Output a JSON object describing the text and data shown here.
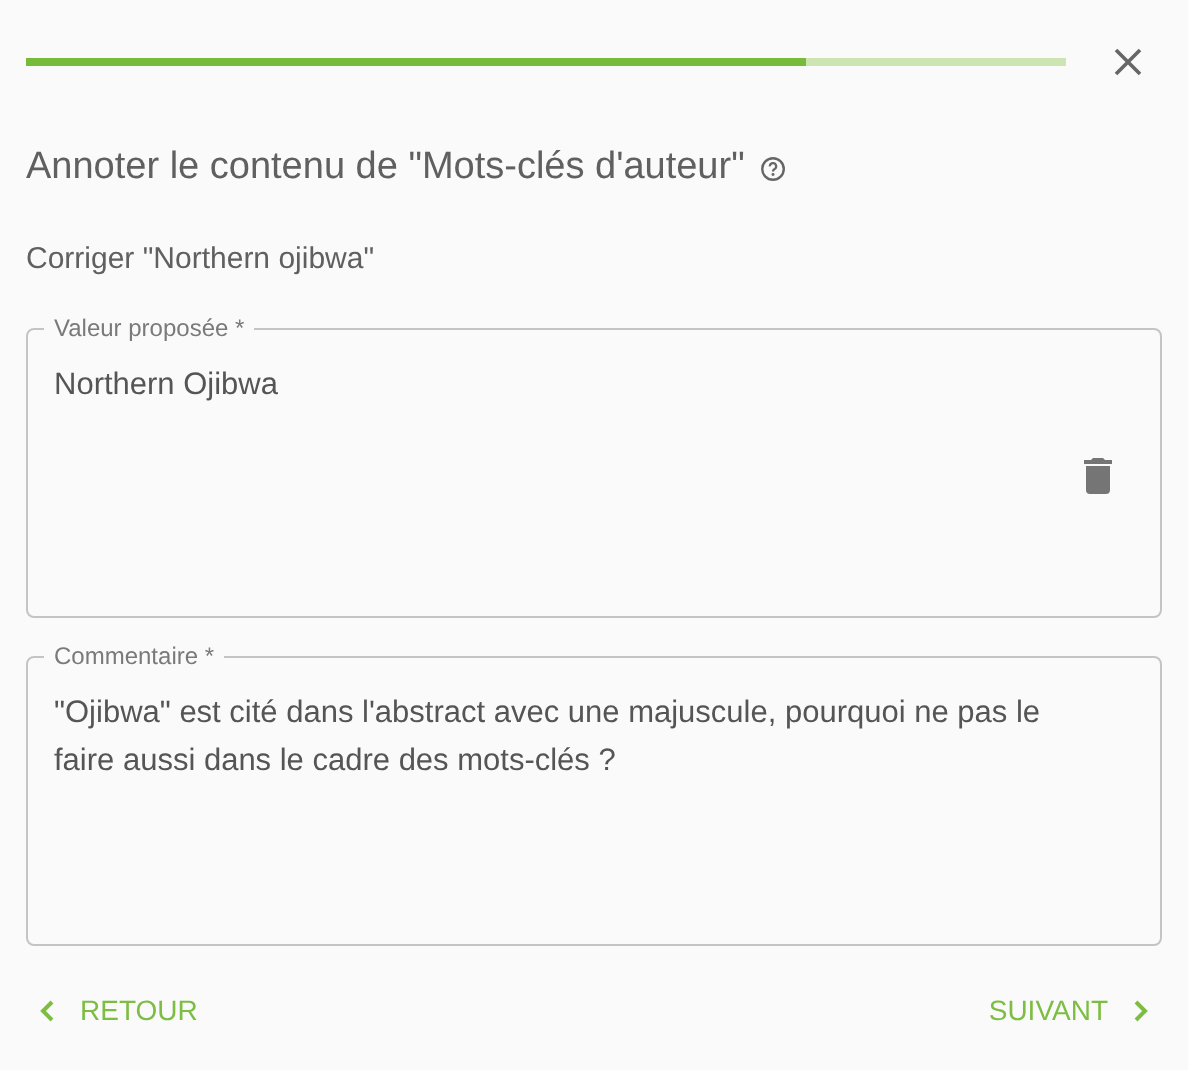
{
  "progress": {
    "level": 0.75
  },
  "title": "Annoter le contenu de \"Mots-clés d'auteur\"",
  "subtitle": "Corriger \"Northern ojibwa\"",
  "fields": [
    {
      "label": "Valeur proposée *",
      "value": "Northern Ojibwa",
      "deletable": true
    },
    {
      "label": "Commentaire *",
      "value": "\"Ojibwa\" est cité dans l'abstract avec une majuscule, pourquoi ne pas le faire aussi dans le cadre des mots-clés ?",
      "deletable": false
    }
  ],
  "buttons": {
    "back": "RETOUR",
    "next": "SUIVANT"
  }
}
